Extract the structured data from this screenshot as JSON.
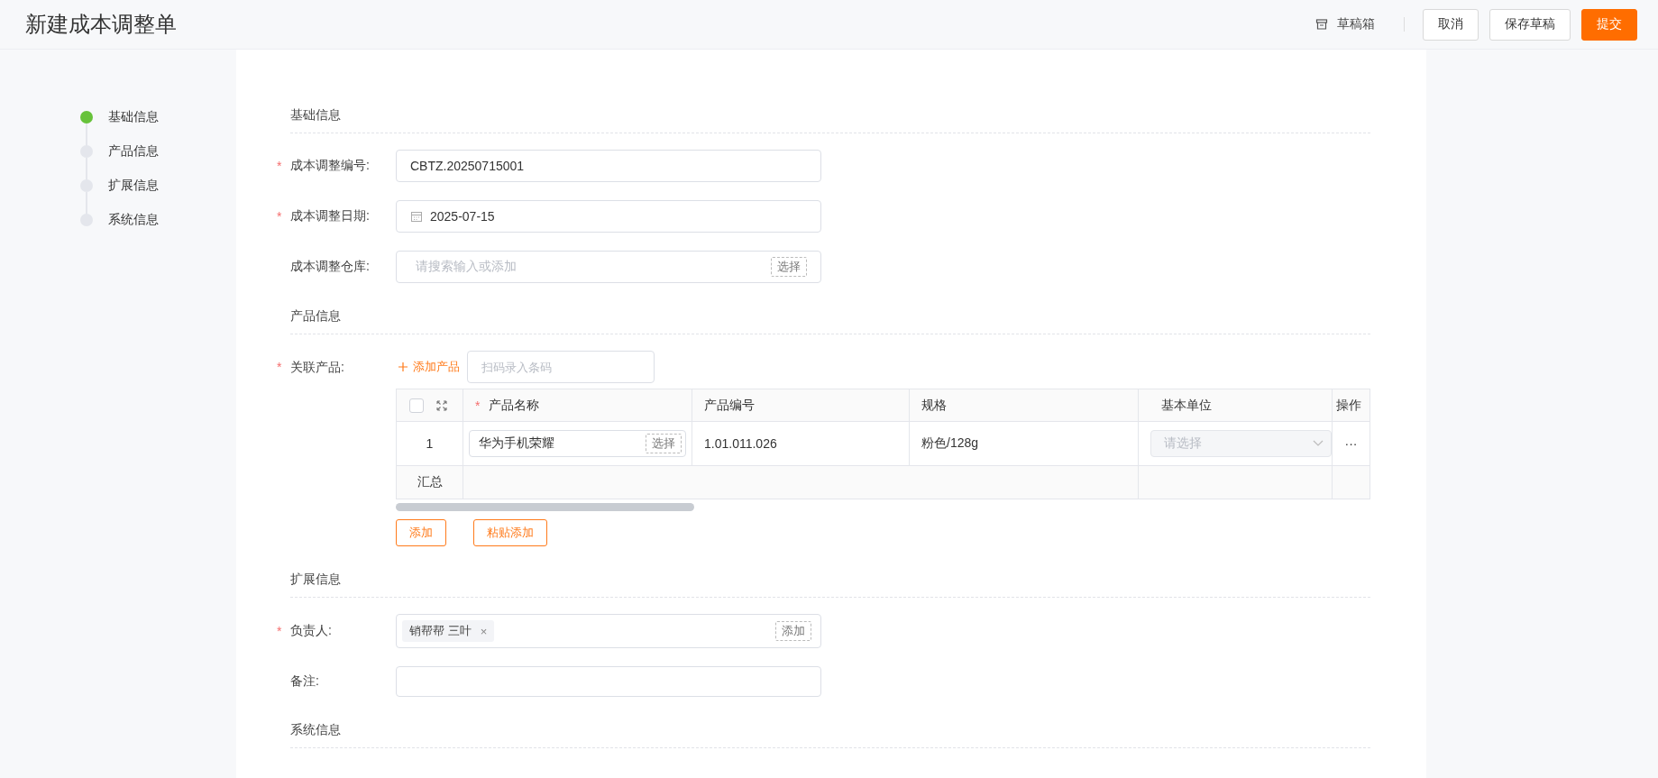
{
  "header": {
    "title": "新建成本调整单",
    "drafts": "草稿箱",
    "buttons": [
      {
        "label": "取消",
        "kind": "default"
      },
      {
        "label": "保存草稿",
        "kind": "default"
      },
      {
        "label": "提交",
        "kind": "primary"
      }
    ]
  },
  "steps": [
    {
      "label": "基础信息",
      "selected": true
    },
    {
      "label": "产品信息",
      "selected": false
    },
    {
      "label": "扩展信息",
      "selected": false
    },
    {
      "label": "系统信息",
      "selected": false
    }
  ],
  "sections": [
    {
      "title": "基础信息",
      "fields": [
        {
          "kind": "text",
          "label": "成本调整编号:",
          "mark": "*",
          "value": "CBTZ.20250715001"
        },
        {
          "kind": "date",
          "label": "成本调整日期:",
          "mark": "*",
          "value": "2025-07-15"
        },
        {
          "kind": "select",
          "label": "成本调整仓库:",
          "placeholder": "请搜索输入或添加",
          "action": "选择"
        }
      ]
    },
    {
      "title": "产品信息",
      "fields": [
        {
          "kind": "products",
          "label": "关联产品:",
          "mark": "*",
          "add_link": "添加产品",
          "scan_placeholder": "扫码录入条码",
          "table": {
            "select_all_checked": false,
            "columns": [
              {
                "label": "产品名称",
                "mark": "*"
              },
              {
                "label": "产品编号"
              },
              {
                "label": "规格"
              },
              {
                "label": "基本单位"
              },
              {
                "label": "操作"
              }
            ],
            "rows": [
              {
                "index": "1",
                "name": "华为手机荣耀",
                "name_action": "选择",
                "code": "1.01.011.026",
                "spec": "粉色/128g",
                "unit_placeholder": "请选择",
                "unit_disabled": true,
                "more": "···"
              }
            ],
            "summary": "汇总"
          },
          "buttons": [
            "添加",
            "粘贴添加"
          ]
        }
      ]
    },
    {
      "title": "扩展信息",
      "fields": [
        {
          "kind": "tags",
          "label": "负责人:",
          "mark": "*",
          "tags": [
            {
              "label": "销帮帮 三叶",
              "remove": "×"
            }
          ],
          "action": "添加"
        },
        {
          "kind": "textarea",
          "label": "备注:"
        }
      ]
    },
    {
      "title": "系统信息"
    }
  ]
}
